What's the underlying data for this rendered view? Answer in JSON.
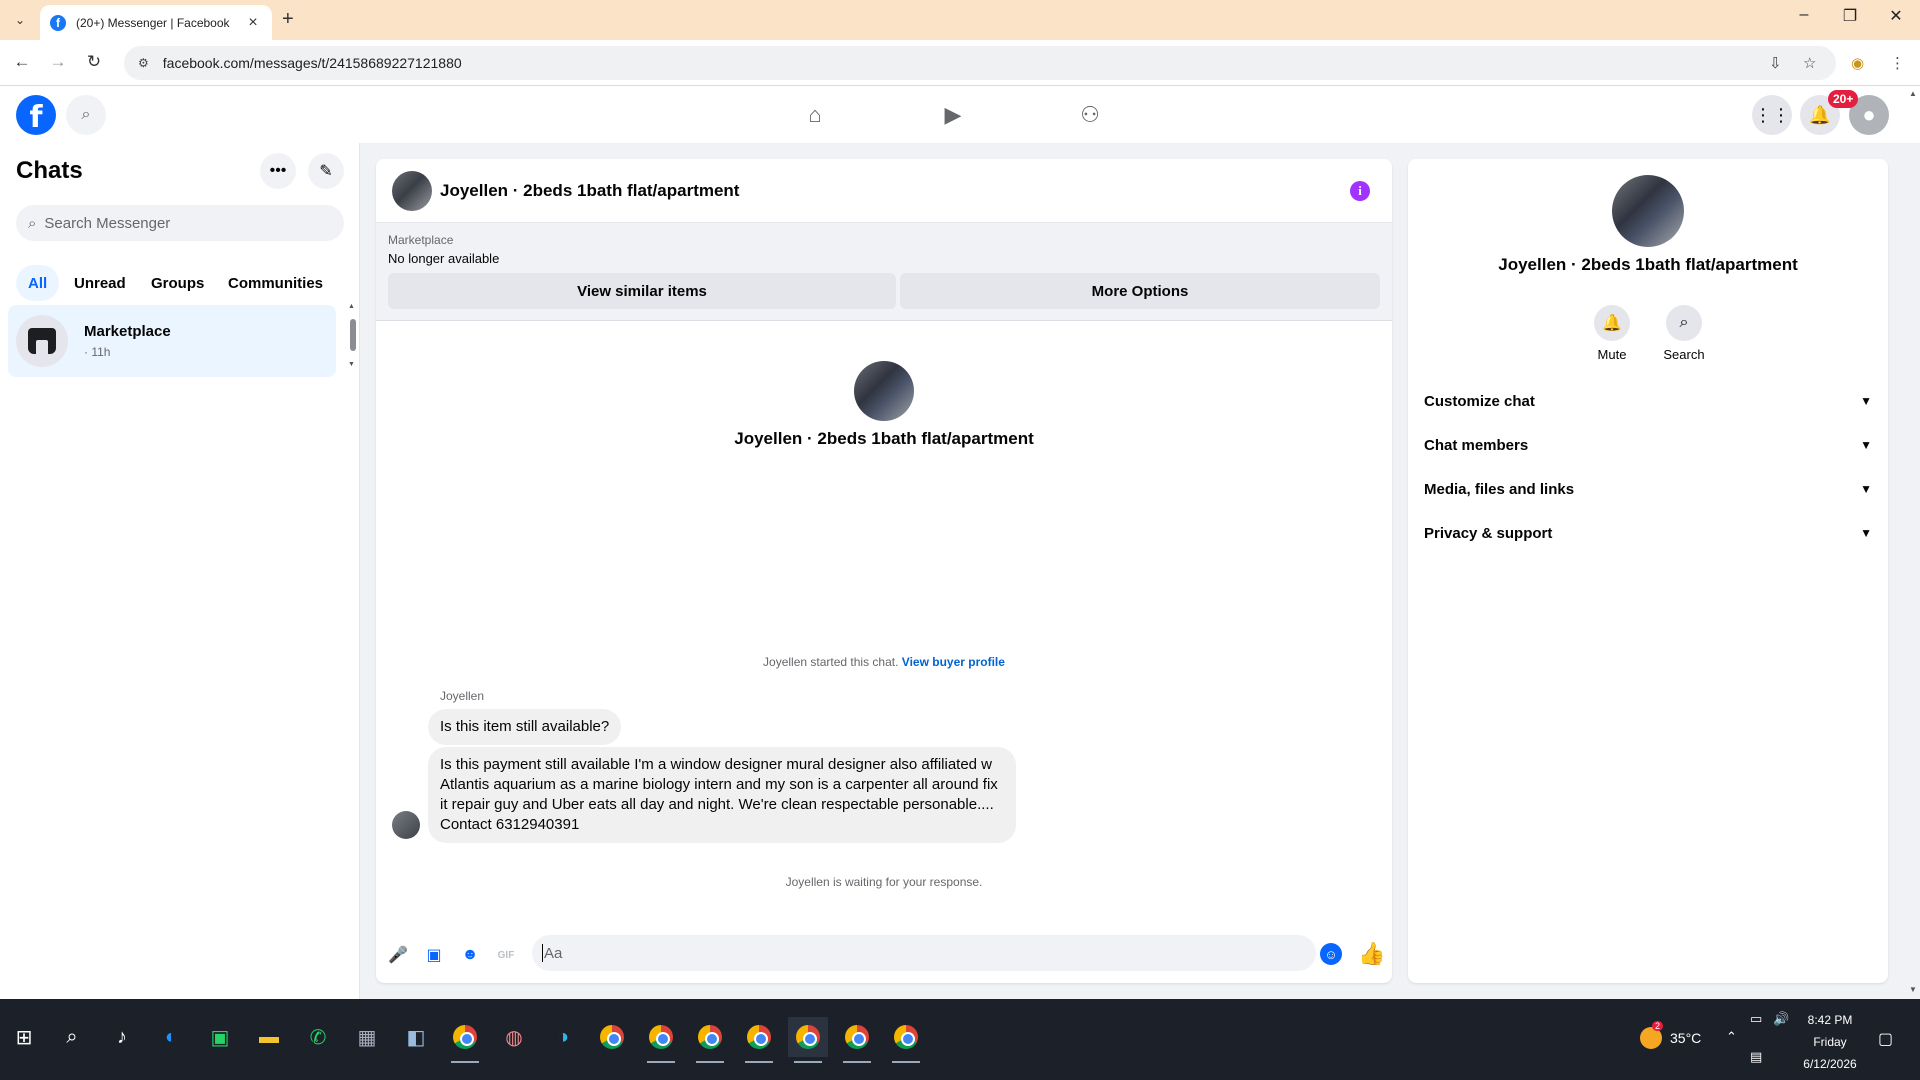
{
  "browser": {
    "tab_title": "(20+) Messenger | Facebook",
    "favicon": "f",
    "url": "facebook.com/messages/t/24158689227121880"
  },
  "header": {
    "notification_badge": "20+"
  },
  "sidebar": {
    "title": "Chats",
    "search_placeholder": "Search Messenger",
    "filters": [
      "All",
      "Unread",
      "Groups",
      "Communities"
    ],
    "active_filter": "All",
    "chats": [
      {
        "name": "Marketplace",
        "time": "· 11h",
        "icon": "marketplace-store-icon"
      }
    ]
  },
  "conversation": {
    "title": "Joyellen · 2beds 1bath flat/apartment",
    "marketplace_label": "Marketplace",
    "listing_status": "No longer available",
    "view_similar_label": "View similar items",
    "more_options_label": "More Options",
    "intro_name": "Joyellen · 2beds 1bath flat/apartment",
    "started_text": "Joyellen started this chat.",
    "view_buyer_profile": "View buyer profile",
    "sender": "Joyellen",
    "messages": [
      "Is this item still available?",
      "Is this payment still available I'm a window designer mural designer also affiliated w Atlantis aquarium as a marine biology intern and my son is a carpenter all around fix it repair guy and Uber eats all day and night. We're clean respectable personable.... Contact 6312940391"
    ],
    "waiting_text": "Joyellen is waiting for your response.",
    "composer_placeholder": "Aa"
  },
  "info_panel": {
    "name": "Joyellen · 2beds 1bath flat/apartment",
    "actions": [
      "Mute",
      "Search"
    ],
    "sections": [
      "Customize chat",
      "Chat members",
      "Media, files and links",
      "Privacy & support"
    ]
  },
  "taskbar": {
    "temperature": "35°C",
    "weather_badge": "2",
    "time": "8:42 PM",
    "day": "Friday",
    "date": "6/12/2026"
  },
  "colors": {
    "fb_blue": "#0866ff",
    "active_filter_bg": "#ebf5ff",
    "info_purple": "#a033ff",
    "link": "#0064d1"
  }
}
